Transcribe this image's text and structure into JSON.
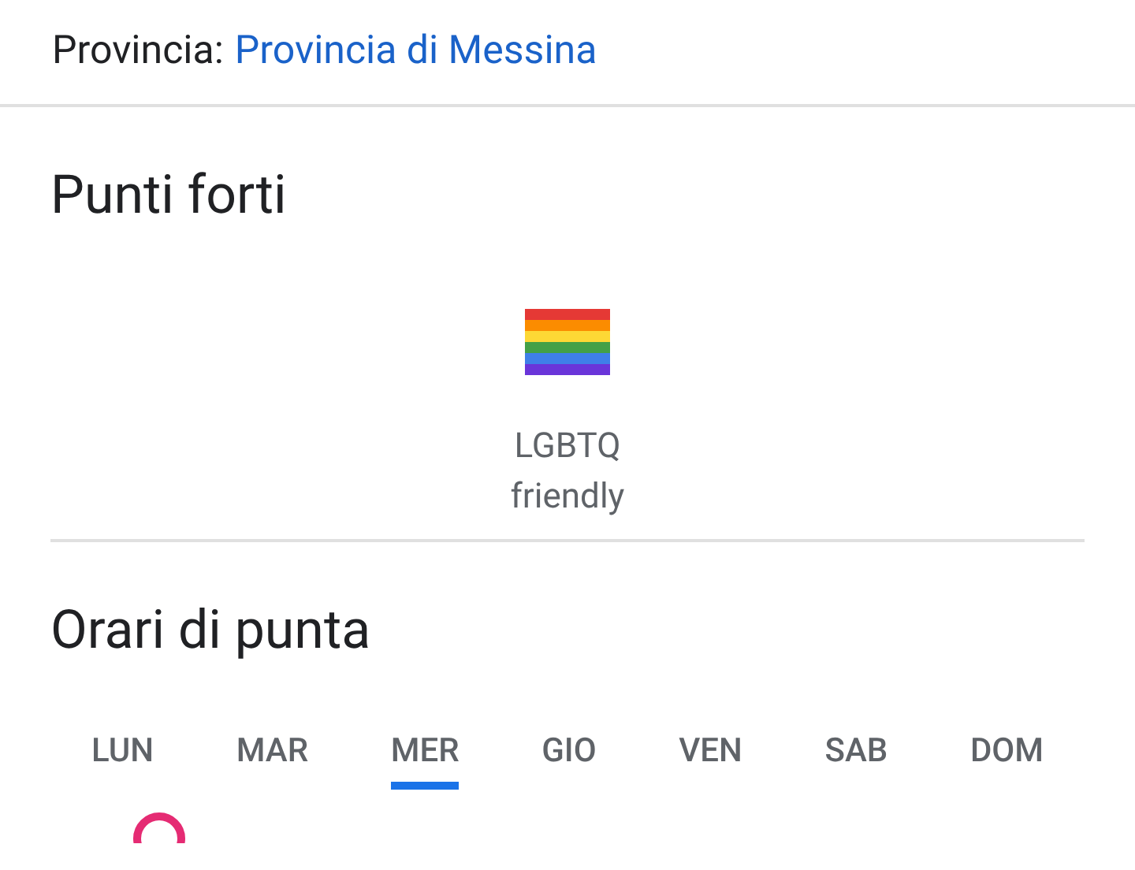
{
  "province": {
    "label": "Provincia:",
    "link": "Provincia di Messina"
  },
  "highlights": {
    "title": "Punti forti",
    "items": [
      {
        "label": "LGBTQ friendly"
      }
    ]
  },
  "popular_times": {
    "title": "Orari di punta",
    "days": [
      {
        "label": "LUN",
        "selected": false
      },
      {
        "label": "MAR",
        "selected": false
      },
      {
        "label": "MER",
        "selected": true
      },
      {
        "label": "GIO",
        "selected": false
      },
      {
        "label": "VEN",
        "selected": false
      },
      {
        "label": "SAB",
        "selected": false
      },
      {
        "label": "DOM",
        "selected": false
      }
    ]
  }
}
